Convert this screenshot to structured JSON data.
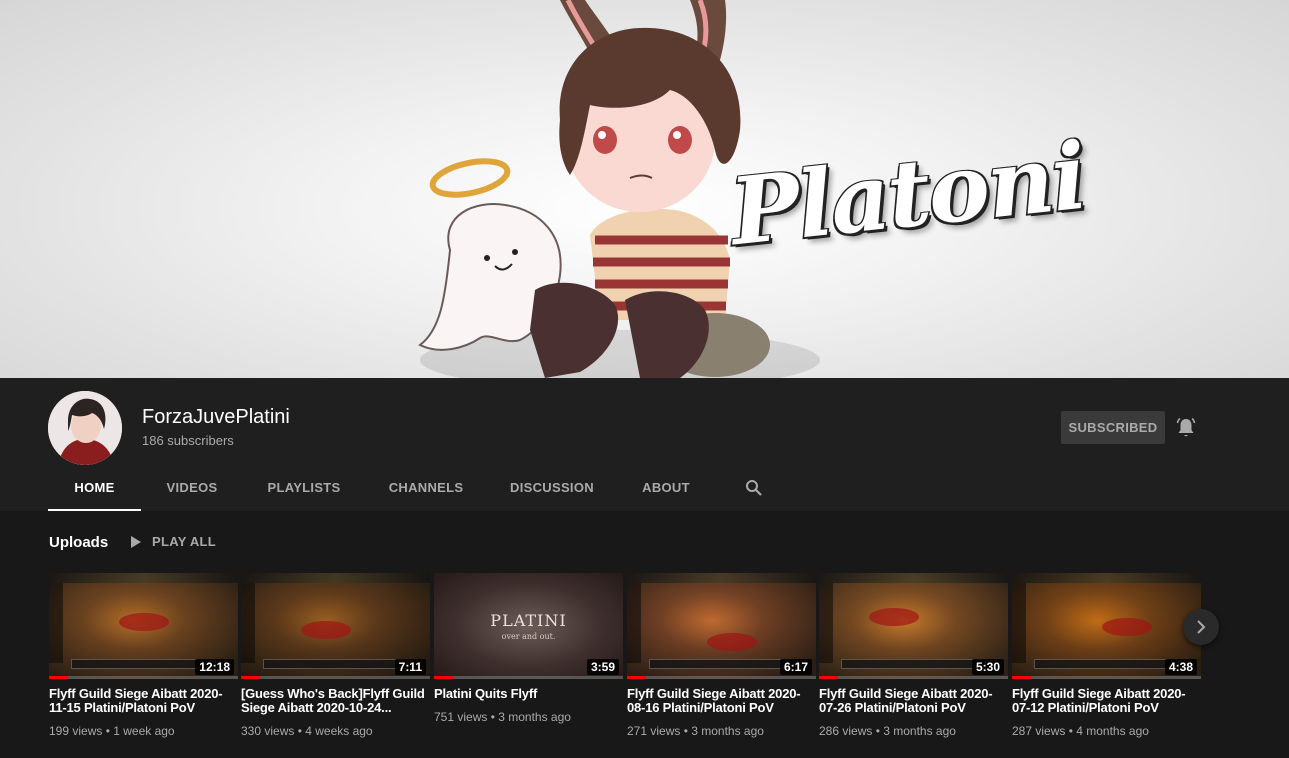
{
  "banner": {
    "title": "Platoni"
  },
  "channel": {
    "name": "ForzaJuvePlatini",
    "subscribers": "186 subscribers",
    "subscribe_label": "SUBSCRIBED",
    "bell_icon": "bell-icon"
  },
  "tabs": [
    {
      "label": "HOME",
      "active": true
    },
    {
      "label": "VIDEOS",
      "active": false
    },
    {
      "label": "PLAYLISTS",
      "active": false
    },
    {
      "label": "CHANNELS",
      "active": false
    },
    {
      "label": "DISCUSSION",
      "active": false
    },
    {
      "label": "ABOUT",
      "active": false
    }
  ],
  "search_icon": "search-icon",
  "uploads": {
    "title": "Uploads",
    "play_all": "PLAY ALL",
    "videos": [
      {
        "title": "Flyff Guild Siege Aibatt 2020-11-15 Platini/Platoni PoV",
        "meta": "199 views • 1 week ago",
        "duration": "12:18",
        "watched": 0.1
      },
      {
        "title": "[Guess Who's Back]Flyff Guild Siege Aibatt 2020-10-24...",
        "meta": "330 views • 4 weeks ago",
        "duration": "7:11",
        "watched": 0.1
      },
      {
        "title": "Platini Quits Flyff",
        "meta": "751 views • 3 months ago",
        "duration": "3:59",
        "watched": 0.1,
        "thumb_title": "PLATINI",
        "thumb_subtitle": "over and out."
      },
      {
        "title": "Flyff Guild Siege Aibatt 2020-08-16 Platini/Platoni PoV",
        "meta": "271 views • 3 months ago",
        "duration": "6:17",
        "watched": 0.1
      },
      {
        "title": "Flyff Guild Siege Aibatt 2020-07-26 Platini/Platoni PoV",
        "meta": "286 views • 3 months ago",
        "duration": "5:30",
        "watched": 0.1
      },
      {
        "title": "Flyff Guild Siege Aibatt 2020-07-12 Platini/Platoni PoV",
        "meta": "287 views • 4 months ago",
        "duration": "4:38",
        "watched": 0.1
      }
    ]
  },
  "colors": {
    "background": "#181818",
    "header": "#1f1f1f",
    "accent": "#ff0000",
    "muted_text": "#aaaaaa"
  }
}
